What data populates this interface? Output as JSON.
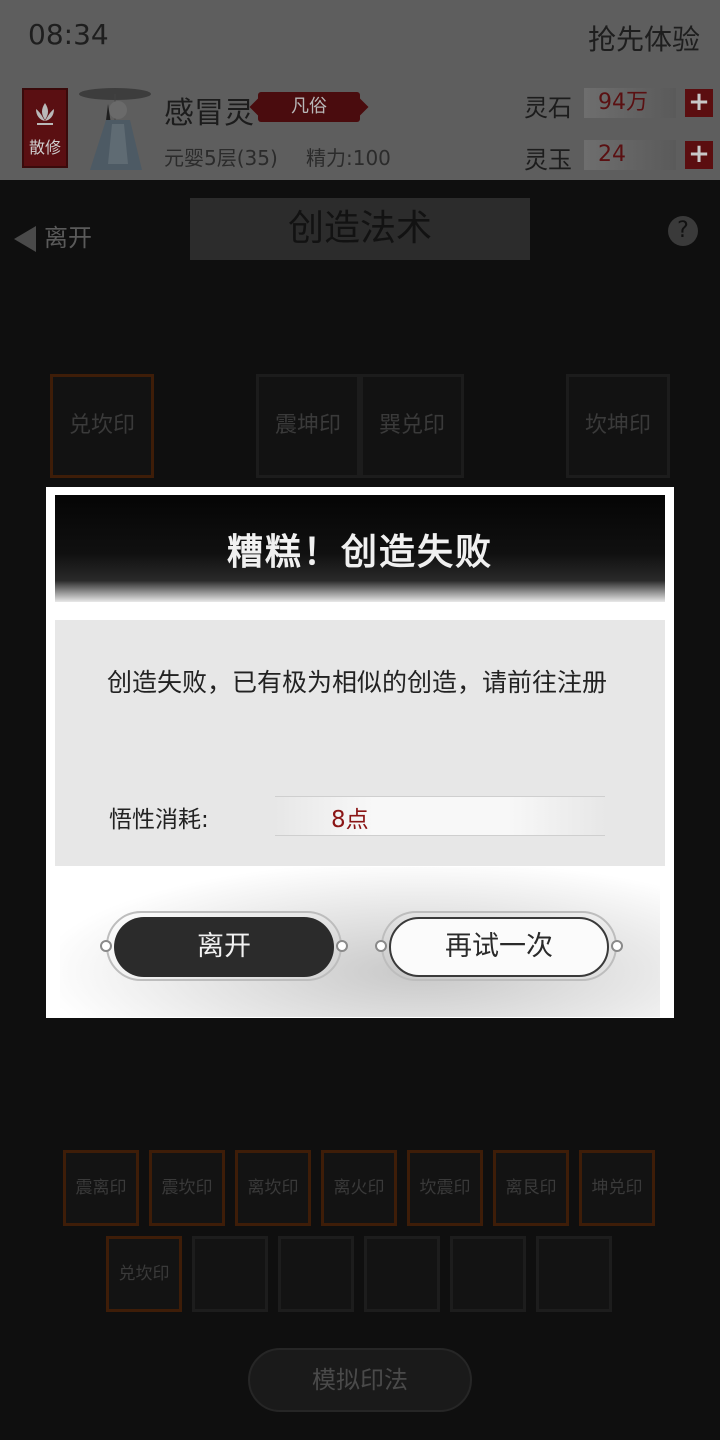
{
  "status": {
    "time": "08:34",
    "preview": "抢先体验"
  },
  "profile": {
    "sect_badge": "散修",
    "name": "感冒灵",
    "realm": "凡俗",
    "level": "元婴5层(35)",
    "energy": "精力:100",
    "currencies": [
      {
        "label": "灵石",
        "value": "94万"
      },
      {
        "label": "灵玉",
        "value": "24"
      }
    ]
  },
  "game": {
    "back_label": "离开",
    "title": "创造法术",
    "help_icon": "?",
    "top_seals": [
      "兑坎印",
      "震坤印",
      "巽兑印",
      "坎坤印"
    ],
    "seal_grid_row1": [
      "震离印",
      "震坎印",
      "离坎印",
      "离火印",
      "坎震印",
      "离艮印",
      "坤兑印"
    ],
    "seal_grid_row2": [
      "兑坎印",
      "",
      "",
      "",
      "",
      ""
    ],
    "simulate_button": "模拟印法"
  },
  "modal": {
    "title": "糟糕！创造失败",
    "message": "创造失败，已有极为相似的创造，请前往注册",
    "cost_label": "悟性消耗:",
    "cost_value": "8点",
    "leave_button": "离开",
    "retry_button": "再试一次"
  }
}
